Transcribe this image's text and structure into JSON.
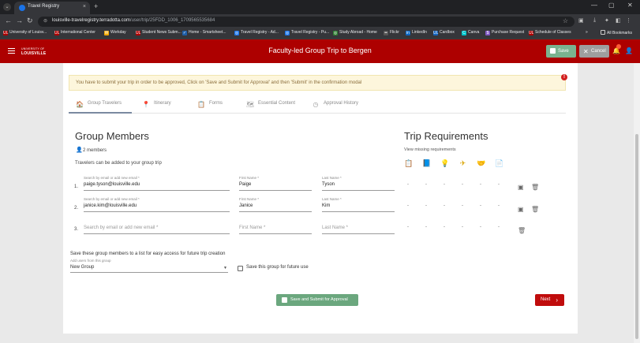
{
  "browser": {
    "tab_title": "Travel Registry",
    "url_host": "louisville-travelregistry.terradotta.com",
    "url_path": "/user/trip/25FDD_1006_1709565535684",
    "bookmarks": [
      {
        "label": "University of Louisv...",
        "color": "#ad0000",
        "glyph": "UL"
      },
      {
        "label": "International Center",
        "color": "#ad0000",
        "glyph": "UL"
      },
      {
        "label": "Workday",
        "color": "#f2a900",
        "glyph": "W"
      },
      {
        "label": "Student News Subm...",
        "color": "#ad0000",
        "glyph": "UL"
      },
      {
        "label": "Home - Smartsheet...",
        "color": "#1f5fa8",
        "glyph": "✓"
      },
      {
        "label": "Travel Registry - Ad...",
        "color": "#1a73e8",
        "glyph": "◎"
      },
      {
        "label": "Travel Registry - Pu...",
        "color": "#1a73e8",
        "glyph": "◎"
      },
      {
        "label": "Study Abroad - Home",
        "color": "#2e7d32",
        "glyph": "◎"
      },
      {
        "label": "Flickr",
        "color": "#e0e0e0",
        "glyph": "••"
      },
      {
        "label": "LinkedIn",
        "color": "#0a66c2",
        "glyph": "in"
      },
      {
        "label": "Cardbox",
        "color": "#1565c0",
        "glyph": "UL"
      },
      {
        "label": "Canva",
        "color": "#00c4cc",
        "glyph": "C"
      },
      {
        "label": "Purchase Request",
        "color": "#7e57c2",
        "glyph": "$"
      },
      {
        "label": "Schedule of Classes",
        "color": "#ad0000",
        "glyph": "UL"
      }
    ],
    "all_bookmarks": "All Bookmarks",
    "more": "»"
  },
  "header": {
    "logo_line1": "UNIVERSITY OF",
    "logo_line2": "LOUISVILLE",
    "title": "Faculty-led Group Trip to Bergen",
    "save_label": "Save",
    "cancel_label": "Cancel",
    "accent": "#ad0000"
  },
  "alert": {
    "text": "You have to submit your trip in order to be approved, Click on 'Save and Submit for Approval' and then 'Submit' in the confirmation modal",
    "icon": "!"
  },
  "tabs": [
    {
      "label": "Group Travelers",
      "icon": "group-travelers-icon",
      "active": true
    },
    {
      "label": "Itinerary",
      "icon": "map-pin-icon",
      "active": false
    },
    {
      "label": "Forms",
      "icon": "clipboard-icon",
      "active": false
    },
    {
      "label": "Essential Content",
      "icon": "map-icon",
      "active": false
    },
    {
      "label": "Approval History",
      "icon": "clock-icon",
      "active": false
    }
  ],
  "group_members": {
    "heading": "Group Members",
    "count_label": "2 members",
    "helper": "Travelers can be added to your group trip",
    "rows": [
      {
        "num": "1.",
        "email_label": "Search by email or add new email *",
        "email": "paige.tyson@louisville.edu",
        "first_label": "First Name *",
        "first": "Paige",
        "last_label": "Last Name *",
        "last": "Tyson"
      },
      {
        "num": "2.",
        "email_label": "Search by email or add new email *",
        "email": "janice.kim@louisville.edu",
        "first_label": "First Name *",
        "first": "Janice",
        "last_label": "Last Name *",
        "last": "Kim"
      },
      {
        "num": "3.",
        "email_placeholder": "Search by email or add new email *",
        "first_placeholder": "First Name *",
        "last_placeholder": "Last Name *"
      }
    ]
  },
  "trip_requirements": {
    "heading": "Trip Requirements",
    "link": "View missing requirements",
    "icons": [
      "clipboard-icon",
      "document-icon",
      "lightbulb-icon",
      "plane-icon",
      "handshake-icon",
      "form-check-icon"
    ],
    "dash": "-"
  },
  "save_group": {
    "text": "Save these group members to a list for easy access for future trip creation",
    "sub_label": "Add users from this group",
    "select_value": "New Group",
    "checkbox_label": "Save this group for future use"
  },
  "actions": {
    "submit_label": "Save and Submit for Approval",
    "next_label": "Next"
  }
}
